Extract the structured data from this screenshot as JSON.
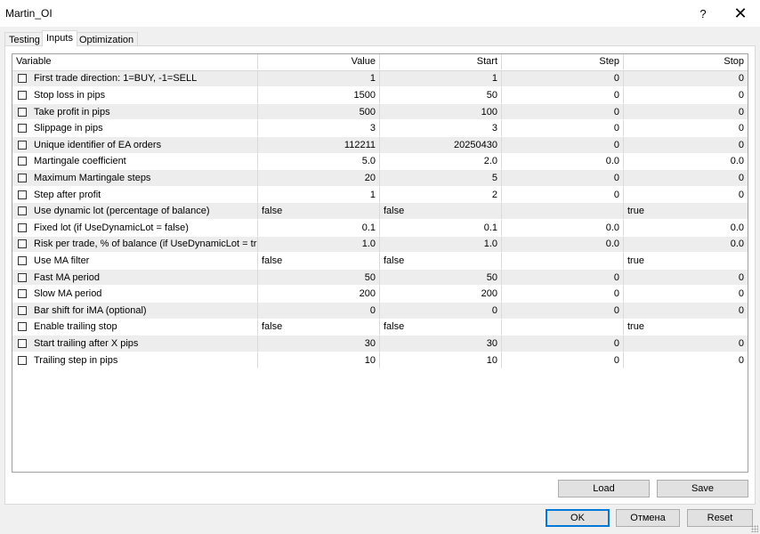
{
  "window": {
    "title": "Martin_OI",
    "help_label": "?",
    "close_label": "✕"
  },
  "tabs": [
    {
      "label": "Testing"
    },
    {
      "label": "Inputs"
    },
    {
      "label": "Optimization"
    }
  ],
  "table": {
    "headers": [
      "Variable",
      "Value",
      "Start",
      "Step",
      "Stop"
    ],
    "rows": [
      {
        "variable": "First trade direction: 1=BUY, -1=SELL",
        "value": "1",
        "start": "1",
        "step": "0",
        "stop": "0"
      },
      {
        "variable": "Stop loss in pips",
        "value": "1500",
        "start": "50",
        "step": "0",
        "stop": "0"
      },
      {
        "variable": "Take profit in pips",
        "value": "500",
        "start": "100",
        "step": "0",
        "stop": "0"
      },
      {
        "variable": "Slippage in pips",
        "value": "3",
        "start": "3",
        "step": "0",
        "stop": "0"
      },
      {
        "variable": "Unique identifier of EA orders",
        "value": "112211",
        "start": "20250430",
        "step": "0",
        "stop": "0"
      },
      {
        "variable": "Martingale coefficient",
        "value": "5.0",
        "start": "2.0",
        "step": "0.0",
        "stop": "0.0"
      },
      {
        "variable": "Maximum Martingale steps",
        "value": "20",
        "start": "5",
        "step": "0",
        "stop": "0"
      },
      {
        "variable": "Step after profit",
        "value": "1",
        "start": "2",
        "step": "0",
        "stop": "0"
      },
      {
        "variable": "Use dynamic lot (percentage of balance)",
        "value": "false",
        "start": "false",
        "step": "",
        "stop": "true"
      },
      {
        "variable": "Fixed lot (if UseDynamicLot = false)",
        "value": "0.1",
        "start": "0.1",
        "step": "0.0",
        "stop": "0.0"
      },
      {
        "variable": "Risk per trade, % of balance (if UseDynamicLot = true)",
        "value": "1.0",
        "start": "1.0",
        "step": "0.0",
        "stop": "0.0"
      },
      {
        "variable": "Use MA filter",
        "value": "false",
        "start": "false",
        "step": "",
        "stop": "true"
      },
      {
        "variable": "Fast MA period",
        "value": "50",
        "start": "50",
        "step": "0",
        "stop": "0"
      },
      {
        "variable": "Slow MA period",
        "value": "200",
        "start": "200",
        "step": "0",
        "stop": "0"
      },
      {
        "variable": "Bar shift for iMA (optional)",
        "value": "0",
        "start": "0",
        "step": "0",
        "stop": "0"
      },
      {
        "variable": "Enable trailing stop",
        "value": "false",
        "start": "false",
        "step": "",
        "stop": "true"
      },
      {
        "variable": "Start trailing after X pips",
        "value": "30",
        "start": "30",
        "step": "0",
        "stop": "0"
      },
      {
        "variable": "Trailing step in pips",
        "value": "10",
        "start": "10",
        "step": "0",
        "stop": "0"
      }
    ]
  },
  "buttons": {
    "load": "Load",
    "save": "Save",
    "ok": "OK",
    "cancel": "Отмена",
    "reset": "Reset"
  }
}
